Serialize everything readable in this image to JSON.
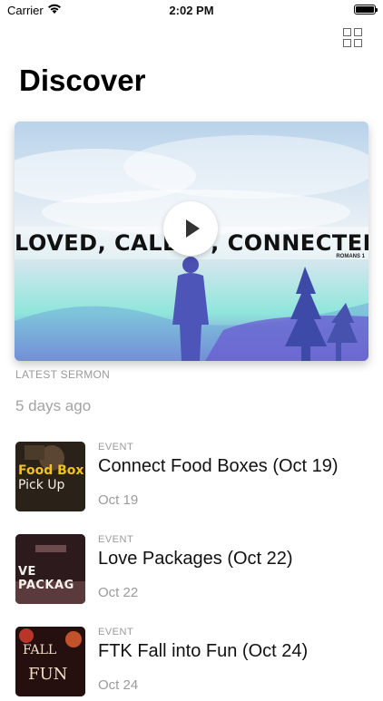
{
  "status": {
    "carrier": "Carrier",
    "time": "2:02 PM"
  },
  "header": {
    "title": "Discover",
    "grid_icon": "grid-icon"
  },
  "hero": {
    "banner_text": "LOVED, CALLED, CONNECTED",
    "banner_sub": "ROMANS 1",
    "section_label": "LATEST SERMON",
    "meta": "5 days ago",
    "play_icon": "play-icon"
  },
  "events": [
    {
      "tag": "EVENT",
      "title": "Connect  Food Boxes (Oct 19)",
      "date": "Oct 19",
      "thumb_line1": "Food Box",
      "thumb_line2": "Pick Up",
      "thumb_bg": "#2a2219"
    },
    {
      "tag": "EVENT",
      "title": "Love Packages (Oct 22)",
      "date": "Oct 22",
      "thumb_line1": "VE PACKAG",
      "thumb_line2": "",
      "thumb_bg": "#3a1f22"
    },
    {
      "tag": "EVENT",
      "title": "FTK Fall into Fun (Oct 24)",
      "date": "Oct 24",
      "thumb_line1": "FALL",
      "thumb_line2": "FUN",
      "thumb_bg": "#26100f"
    }
  ],
  "colors": {
    "muted": "#9a9a9a",
    "thumb_accent": "#f3c21d"
  }
}
